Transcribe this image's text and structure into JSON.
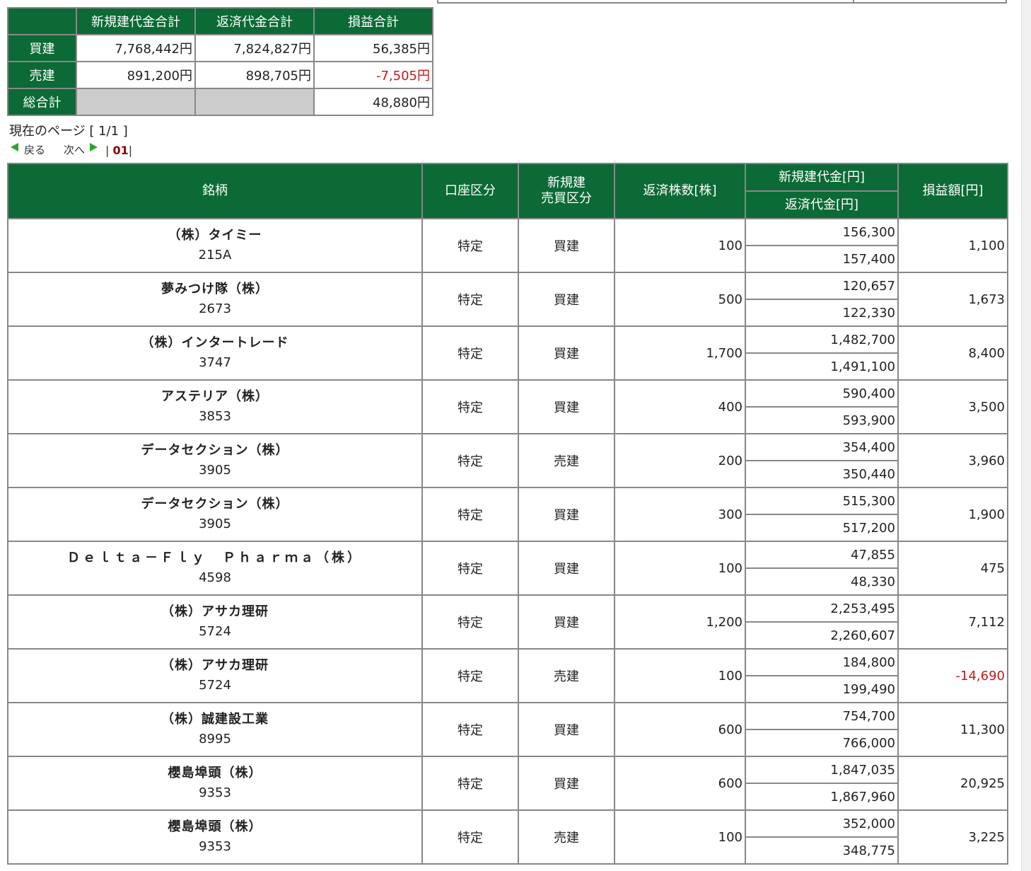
{
  "summary": {
    "headers": [
      "新規建代金合計",
      "返済代金合計",
      "損益合計"
    ],
    "rows": [
      {
        "label": "買建",
        "open_total": "7,768,442円",
        "close_total": "7,824,827円",
        "pl_total": "56,385円",
        "negative": false
      },
      {
        "label": "売建",
        "open_total": "891,200円",
        "close_total": "898,705円",
        "pl_total": "-7,505円",
        "negative": true
      }
    ],
    "grand": {
      "label": "総合計",
      "pl_total": "48,880円"
    }
  },
  "pager": {
    "current_label": "現在のページ [ 1/1 ]",
    "back_label": "戻る",
    "next_label": "次へ",
    "pages": [
      "01"
    ]
  },
  "table": {
    "headers": {
      "name": "銘柄",
      "account": "口座区分",
      "side_line1": "新規建",
      "side_line2": "売買区分",
      "qty": "返済株数[株]",
      "open_amount": "新規建代金[円]",
      "close_amount": "返済代金[円]",
      "pl": "損益額[円]"
    },
    "rows": [
      {
        "name": "（株）タイミー",
        "code": "215A",
        "account": "特定",
        "side": "買建",
        "qty": "100",
        "open": "156,300",
        "close": "157,400",
        "pl": "1,100",
        "negative": false
      },
      {
        "name": "夢みつけ隊（株）",
        "code": "2673",
        "account": "特定",
        "side": "買建",
        "qty": "500",
        "open": "120,657",
        "close": "122,330",
        "pl": "1,673",
        "negative": false
      },
      {
        "name": "（株）インタートレード",
        "code": "3747",
        "account": "特定",
        "side": "買建",
        "qty": "1,700",
        "open": "1,482,700",
        "close": "1,491,100",
        "pl": "8,400",
        "negative": false
      },
      {
        "name": "アステリア（株）",
        "code": "3853",
        "account": "特定",
        "side": "買建",
        "qty": "400",
        "open": "590,400",
        "close": "593,900",
        "pl": "3,500",
        "negative": false
      },
      {
        "name": "データセクション（株）",
        "code": "3905",
        "account": "特定",
        "side": "売建",
        "qty": "200",
        "open": "354,400",
        "close": "350,440",
        "pl": "3,960",
        "negative": false
      },
      {
        "name": "データセクション（株）",
        "code": "3905",
        "account": "特定",
        "side": "買建",
        "qty": "300",
        "open": "515,300",
        "close": "517,200",
        "pl": "1,900",
        "negative": false
      },
      {
        "name": "Ｄｅｌｔａ－Ｆｌｙ　Ｐｈａｒｍａ（株）",
        "code": "4598",
        "account": "特定",
        "side": "買建",
        "qty": "100",
        "open": "47,855",
        "close": "48,330",
        "pl": "475",
        "negative": false
      },
      {
        "name": "（株）アサカ理研",
        "code": "5724",
        "account": "特定",
        "side": "買建",
        "qty": "1,200",
        "open": "2,253,495",
        "close": "2,260,607",
        "pl": "7,112",
        "negative": false
      },
      {
        "name": "（株）アサカ理研",
        "code": "5724",
        "account": "特定",
        "side": "売建",
        "qty": "100",
        "open": "184,800",
        "close": "199,490",
        "pl": "-14,690",
        "negative": true
      },
      {
        "name": "（株）誠建設工業",
        "code": "8995",
        "account": "特定",
        "side": "買建",
        "qty": "600",
        "open": "754,700",
        "close": "766,000",
        "pl": "11,300",
        "negative": false
      },
      {
        "name": "櫻島埠頭（株）",
        "code": "9353",
        "account": "特定",
        "side": "買建",
        "qty": "600",
        "open": "1,847,035",
        "close": "1,867,960",
        "pl": "20,925",
        "negative": false
      },
      {
        "name": "櫻島埠頭（株）",
        "code": "9353",
        "account": "特定",
        "side": "売建",
        "qty": "100",
        "open": "352,000",
        "close": "348,775",
        "pl": "3,225",
        "negative": false
      }
    ]
  },
  "colors": {
    "header_green": "#0b6a35",
    "negative_red": "#c51a1a",
    "grid": "#888888",
    "blank_cell": "#cccccc",
    "pager_arrow": "#2aa52a"
  }
}
